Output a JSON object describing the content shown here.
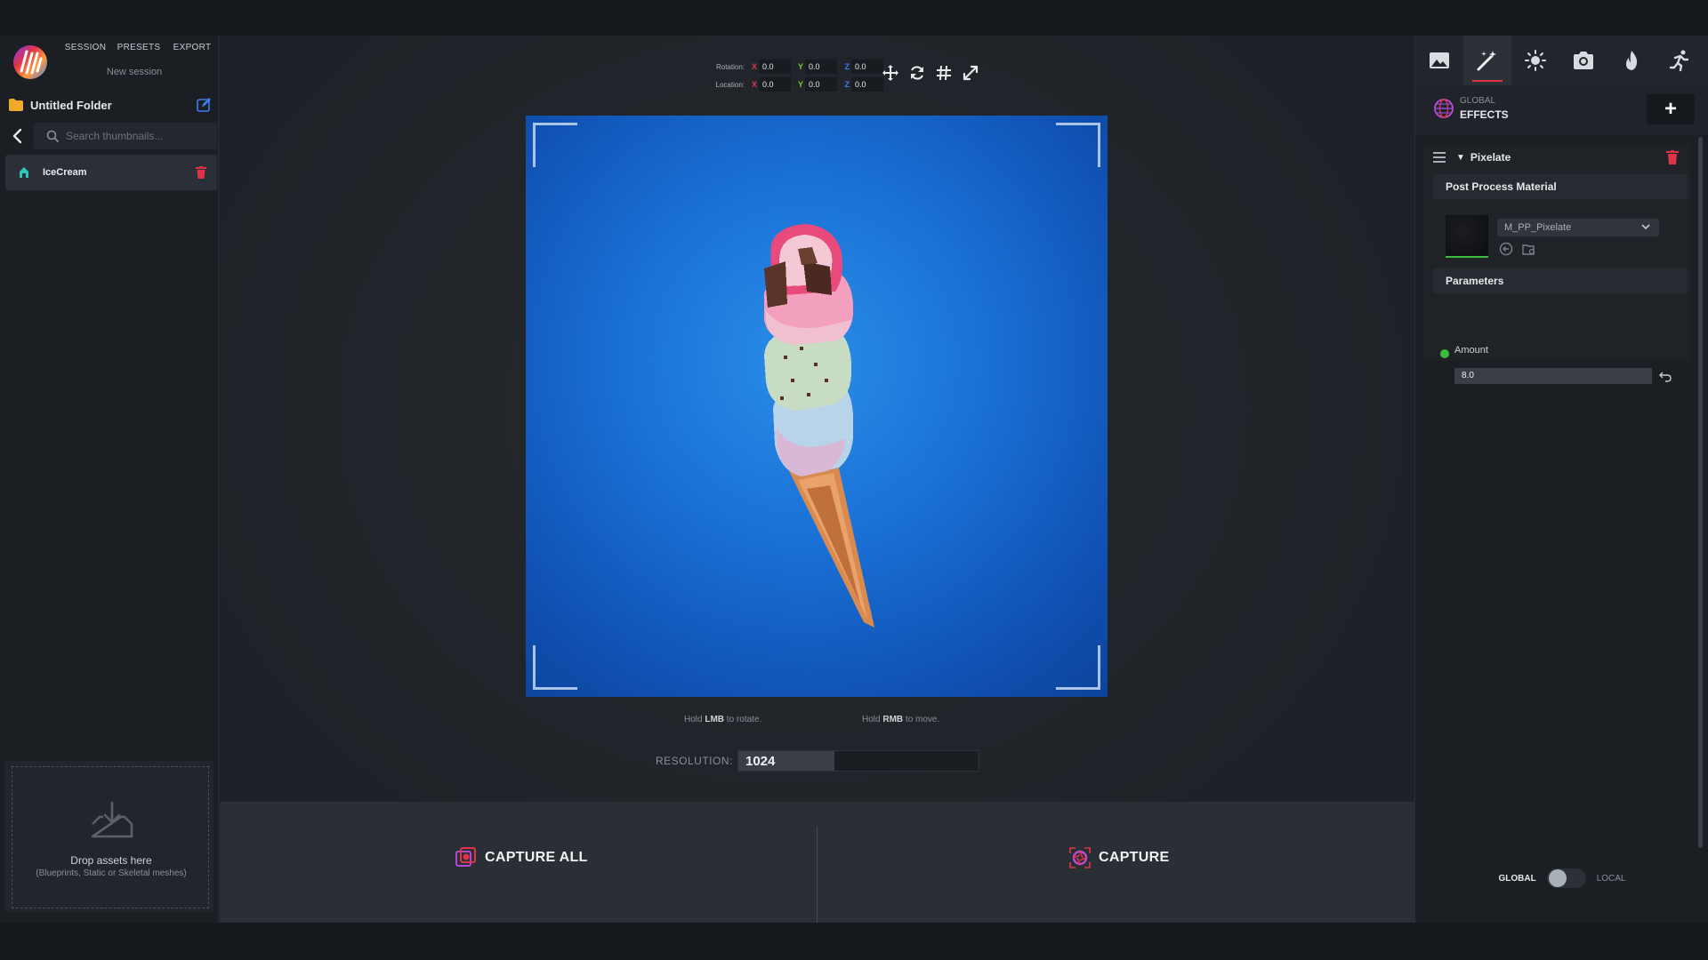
{
  "menu": {
    "session": "SESSION",
    "presets": "PRESETS",
    "export": "EXPORT"
  },
  "session_name": "New session",
  "folder": {
    "name": "Untitled Folder"
  },
  "search": {
    "placeholder": "Search thumbnails..."
  },
  "assets": [
    {
      "name": "IceCream"
    }
  ],
  "drop": {
    "title": "Drop assets here",
    "subtitle": "(Blueprints, Static or Skeletal meshes)"
  },
  "transform": {
    "rotation_label": "Rotation:",
    "location_label": "Location:",
    "axis_x": "X",
    "axis_y": "Y",
    "axis_z": "Z",
    "rotation": {
      "x": "0.0",
      "y": "0.0",
      "z": "0.0"
    },
    "location": {
      "x": "0.0",
      "y": "0.0",
      "z": "0.0"
    }
  },
  "hints": {
    "rotate_pre": "Hold ",
    "rotate_key": "LMB",
    "rotate_post": " to rotate.",
    "move_pre": "Hold ",
    "move_key": "RMB",
    "move_post": " to move."
  },
  "resolution": {
    "label": "RESOLUTION:",
    "value": "1024",
    "fill_fraction": 0.4
  },
  "capture": {
    "all_label": "CAPTURE ALL",
    "single_label": "CAPTURE"
  },
  "right": {
    "tabs": [
      "image-icon",
      "magic-wand-icon",
      "sun-icon",
      "camera-icon",
      "fire-icon",
      "run-icon"
    ],
    "active_tab": 1,
    "header_top": "GLOBAL",
    "header_bottom": "EFFECTS",
    "add_label": "+",
    "effect": {
      "name": "Pixelate",
      "material_section": "Post Process Material",
      "material": "M_PP_Pixelate",
      "params_section": "Parameters",
      "param_name": "Amount",
      "param_value": "8.0"
    },
    "toggle": {
      "left": "GLOBAL",
      "right": "LOCAL"
    }
  },
  "colors": {
    "accent": "#e0334a",
    "green": "#3cbb3c",
    "viewport_blue": "#1a70d6"
  }
}
